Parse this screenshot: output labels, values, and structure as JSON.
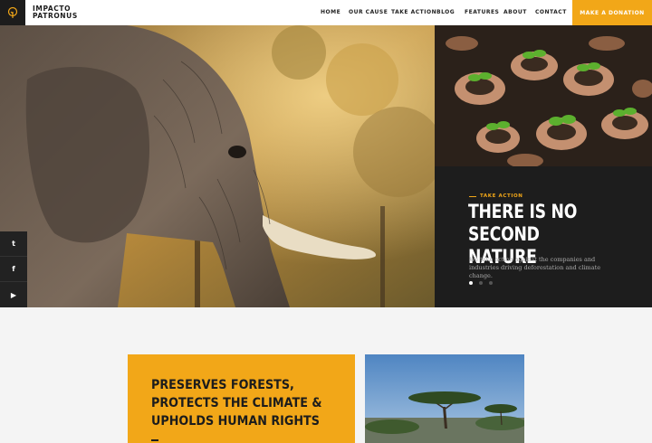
{
  "brand": {
    "line1": "IMPACTO",
    "line2": "PATRONUS",
    "logo_icon": "tree-icon"
  },
  "nav": {
    "items": [
      {
        "label": "HOME"
      },
      {
        "label": "OUR CAUSE"
      },
      {
        "label": "TAKE ACTION"
      },
      {
        "label": "BLOG"
      },
      {
        "label": "FEATURES"
      },
      {
        "label": "ABOUT"
      },
      {
        "label": "CONTACT"
      }
    ],
    "donate_label": "MAKE A DONATION"
  },
  "social": [
    {
      "icon": "twitter-icon",
      "glyph": "t"
    },
    {
      "icon": "facebook-icon",
      "glyph": "f"
    },
    {
      "icon": "youtube-icon",
      "glyph": "▶"
    }
  ],
  "hero": {
    "eyebrow": "TAKE ACTION",
    "title_line1": "THERE IS NO",
    "title_line2": "SECOND NATURE",
    "description": "We take action against the companies and industries driving deforestation and climate change.",
    "slides_total": 3,
    "slide_active": 1
  },
  "card": {
    "line1": "PRESERVES FORESTS,",
    "line2": "PROTECTS THE CLIMATE &",
    "line3": "UPHOLDS HUMAN RIGHTS"
  },
  "colors": {
    "accent": "#f2a718",
    "dark": "#1d1d1d",
    "background": "#f4f4f4"
  }
}
